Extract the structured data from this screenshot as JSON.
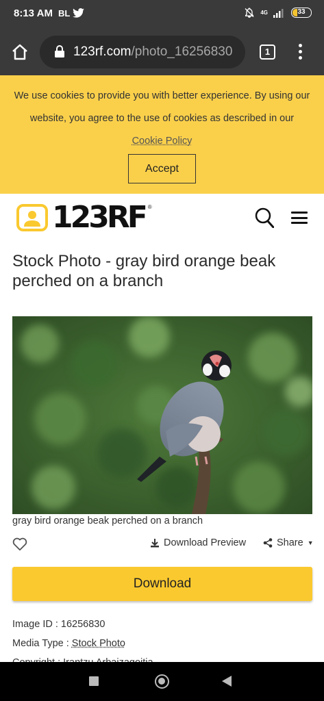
{
  "status_bar": {
    "time": "8:13 AM",
    "carrier": "BL",
    "network": "4G",
    "battery": "33",
    "icons": [
      "twitter-icon",
      "bell-off-icon",
      "signal-icon",
      "battery-icon"
    ]
  },
  "browser": {
    "url_domain": "123rf.com",
    "url_path": "/photo_16256830",
    "tab_count": "1",
    "icons": [
      "home-icon",
      "lock-icon",
      "more-vert-icon"
    ]
  },
  "cookie_banner": {
    "text": "We use cookies to provide you with better experience. By using our website, you agree to the use of cookies as described in our",
    "link_text": "Cookie Policy",
    "accept_label": "Accept",
    "background_color": "#fad04b"
  },
  "site_header": {
    "logo_text": "123RF",
    "logo_reg": "®",
    "icons": [
      "search-icon",
      "hamburger-menu-icon"
    ]
  },
  "page": {
    "title": "Stock Photo - gray bird orange beak perched on a branch",
    "caption": "gray bird orange beak perched on a branch",
    "download_preview_label": "Download Preview",
    "share_label": "Share",
    "download_label": "Download",
    "accent_color": "#fac92f"
  },
  "meta": {
    "image_id_label": "Image ID : ",
    "image_id": "16256830",
    "media_type_label": "Media Type : ",
    "media_type": "Stock Photo",
    "copyright_label": "Copyright : ",
    "copyright": "Irantzu Arbaizagoitia"
  }
}
